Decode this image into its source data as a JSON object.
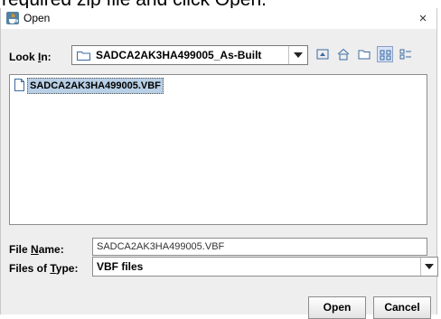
{
  "caption": "required zip file and click Open.",
  "window": {
    "title": "Open",
    "close_glyph": "×"
  },
  "lookin": {
    "label": "Look In:",
    "label_pre": "Look ",
    "label_mnemonic": "I",
    "label_post": "n:",
    "value": "SADCA2AK3HA499005_As-Built"
  },
  "toolbar": {
    "icons": [
      "up-one-level-icon",
      "home-icon",
      "new-folder-icon",
      "list-view-icon",
      "details-view-icon"
    ],
    "active": "list-view-icon"
  },
  "files": [
    {
      "name": "SADCA2AK3HA499005.VBF",
      "selected": true
    }
  ],
  "filename": {
    "label_pre": "File ",
    "label_mnemonic": "N",
    "label_post": "ame:",
    "value": "SADCA2AK3HA499005.VBF"
  },
  "filetype": {
    "label_pre": "Files of ",
    "label_mnemonic": "T",
    "label_post": "ype:",
    "value": "VBF files"
  },
  "buttons": {
    "open": "Open",
    "cancel": "Cancel"
  },
  "colors": {
    "selection": "#b8cfe5",
    "panel": "#eeeeee",
    "active_toggle": "#d7e3f7"
  }
}
